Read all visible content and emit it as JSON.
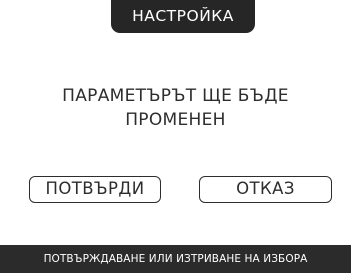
{
  "header": {
    "title": "НАСТРОЙКА"
  },
  "dialog": {
    "message": "ПАРАМЕТЪРЪТ ЩЕ БЪДЕ\nПРОМЕНЕН",
    "confirm_label": "ПОТВЪРДИ",
    "cancel_label": "ОТКАЗ"
  },
  "footer": {
    "hint": "ПОТВЪРЖДАВАНЕ ИЛИ ИЗТРИВАНЕ НА ИЗБОРА"
  },
  "colors": {
    "background": "#ffffff",
    "dark": "#2b2b2b",
    "text": "#2d2d2d"
  }
}
